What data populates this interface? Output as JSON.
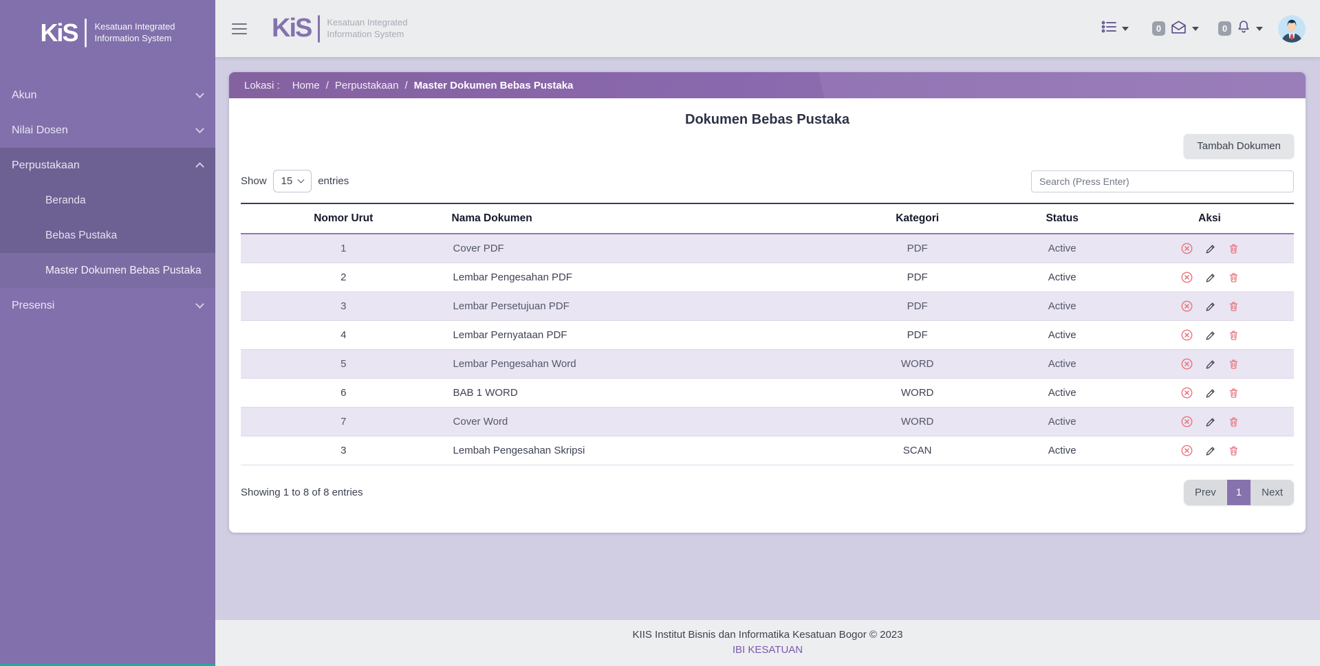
{
  "brand": {
    "mark": "KiS",
    "line1": "Kesatuan Integrated",
    "line2": "Information System"
  },
  "sidebar": {
    "items": [
      {
        "label": "Akun"
      },
      {
        "label": "Nilai Dosen"
      },
      {
        "label": "Perpustakaan",
        "children": [
          {
            "label": "Beranda"
          },
          {
            "label": "Bebas Pustaka"
          },
          {
            "label": "Master Dokumen Bebas Pustaka"
          }
        ]
      },
      {
        "label": "Presensi"
      }
    ]
  },
  "header": {
    "mail_badge": "0",
    "notification_badge": "0"
  },
  "breadcrumb": {
    "prefix": "Lokasi :",
    "home": "Home",
    "section": "Perpustakaan",
    "current": "Master Dokumen Bebas Pustaka",
    "separator": "/"
  },
  "page": {
    "title": "Dokumen Bebas Pustaka",
    "add_button": "Tambah Dokumen",
    "show_label": "Show",
    "page_size": "15",
    "entries_label": "entries",
    "search_placeholder": "Search (Press Enter)"
  },
  "table": {
    "columns": [
      "Nomor Urut",
      "Nama Dokumen",
      "Kategori",
      "Status",
      "Aksi"
    ],
    "rows": [
      {
        "no": "1",
        "name": "Cover PDF",
        "kategori": "PDF",
        "status": "Active"
      },
      {
        "no": "2",
        "name": "Lembar Pengesahan PDF",
        "kategori": "PDF",
        "status": "Active"
      },
      {
        "no": "3",
        "name": "Lembar Persetujuan PDF",
        "kategori": "PDF",
        "status": "Active"
      },
      {
        "no": "4",
        "name": "Lembar Pernyataan PDF",
        "kategori": "PDF",
        "status": "Active"
      },
      {
        "no": "5",
        "name": "Lembar Pengesahan Word",
        "kategori": "WORD",
        "status": "Active"
      },
      {
        "no": "6",
        "name": "BAB 1 WORD",
        "kategori": "WORD",
        "status": "Active"
      },
      {
        "no": "7",
        "name": "Cover Word",
        "kategori": "WORD",
        "status": "Active"
      },
      {
        "no": "3",
        "name": "Lembah Pengesahan Skripsi",
        "kategori": "SCAN",
        "status": "Active"
      }
    ]
  },
  "pagination": {
    "summary": "Showing 1 to 8 of 8 entries",
    "prev": "Prev",
    "current": "1",
    "next": "Next"
  },
  "footer": {
    "copyright": "KIIS Institut Bisnis dan Informatika Kesatuan Bogor © 2023",
    "link": "IBI KESATUAN"
  },
  "colors": {
    "sidebar": "#8170ac",
    "breadcrumb": "#8a68ad",
    "action_red": "#e8747e",
    "active_page": "#8672ac",
    "teal_accent": "#25a79e"
  }
}
